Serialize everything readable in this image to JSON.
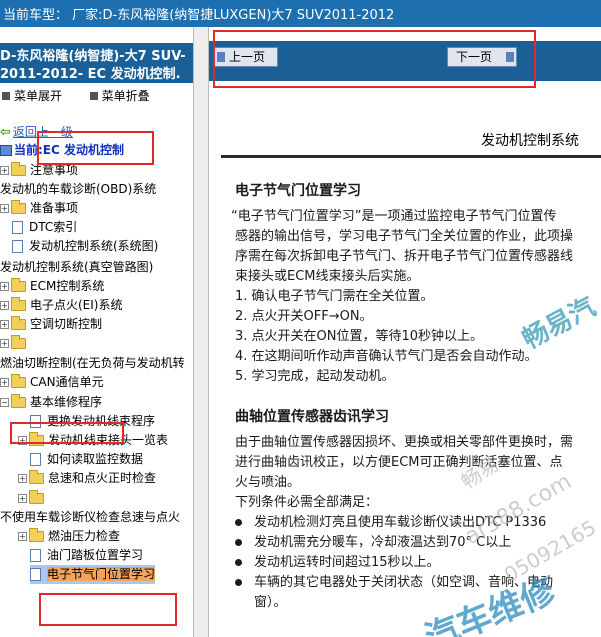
{
  "topbar": {
    "text": "当前车型：  厂家:D-东风裕隆(纳智捷LUXGEN)大7 SUV2011-2012"
  },
  "left": {
    "header_line1": "D-东风裕隆(纳智捷)-大7 SUV-",
    "header_line2": "2011-2012- EC 发动机控制.",
    "expand_label": "菜单展开",
    "collapse_label": "菜单折叠",
    "back_label": "返回上一级",
    "current_label": "当前:EC 发动机控制",
    "tree": [
      {
        "label": "注意事项"
      },
      {
        "label": "发动机的车载诊断(OBD)系统"
      },
      {
        "label": "准备事项"
      },
      {
        "label": "DTC索引"
      },
      {
        "label": "发动机控制系统(系统图)"
      },
      {
        "label": "发动机控制系统(真空管路图)"
      },
      {
        "label": "ECM控制系统"
      },
      {
        "label": "电子点火(EI)系统"
      },
      {
        "label": "空调切断控制"
      },
      {
        "label": ""
      },
      {
        "label": "燃油切断控制(在无负荷与发动机转"
      },
      {
        "label": "CAN通信单元"
      },
      {
        "label": "基本维修程序"
      },
      {
        "label": "更换发动机线束程序"
      },
      {
        "label": "发动机线束接头一览表"
      },
      {
        "label": "如何读取监控数据"
      },
      {
        "label": "怠速和点火正时检查"
      },
      {
        "label": ""
      },
      {
        "label": "不使用车载诊断仪检查怠速与点火"
      },
      {
        "label": "燃油压力检查"
      },
      {
        "label": "油门踏板位置学习"
      },
      {
        "label": "电子节气门位置学习"
      }
    ]
  },
  "nav": {
    "prev_label": "上一页",
    "next_label": "下一页"
  },
  "doc": {
    "title": "发动机控制系统",
    "section1_title": "电子节气门位置学习",
    "section1_para": [
      "“电子节气门位置学习”是一项通过监控电子节气门位置传",
      "感器的输出信号，学习电子节气门全关位置的作业，此项操",
      "序需在每次拆卸电子节气门、拆开电子节气门位置传感器线",
      "束接头或ECM线束接头后实施。"
    ],
    "steps": [
      "1.  确认电子节气门需在全关位置。",
      "2.  点火开关OFF→ON。",
      "3.  点火开关在ON位置，等待10秒钟以上。",
      "4.  在这期间听作动声音确认节气门是否会自动作动。",
      "5.  学习完成，起动发动机。"
    ],
    "section2_title": "曲轴位置传感器齿讯学习",
    "section2_para": [
      "由于曲轴位置传感器因损坏、更换或相关零部件更换时，需",
      "进行曲轴齿讯校正，以方便ECM可正确判断活塞位置、点",
      "火与喷油。"
    ],
    "conditions_intro": "下列条件必需全部满足：",
    "conditions": [
      "发动机检测灯亮且使用车载诊断仪读出DTC P1336",
      "发动机需充分暖车，冷却液温达到70° C以上",
      "发动机运转时间超过15秒以上。",
      "车辆的其它电器处于关闭状态（如空调、音响、电动",
      "窗）。"
    ],
    "watermark_main": "畅易汽",
    "watermark_bottom": "汽车维修",
    "watermark_url": "ar388.com",
    "watermark_num": "05092165",
    "watermark_small": "畅易"
  }
}
